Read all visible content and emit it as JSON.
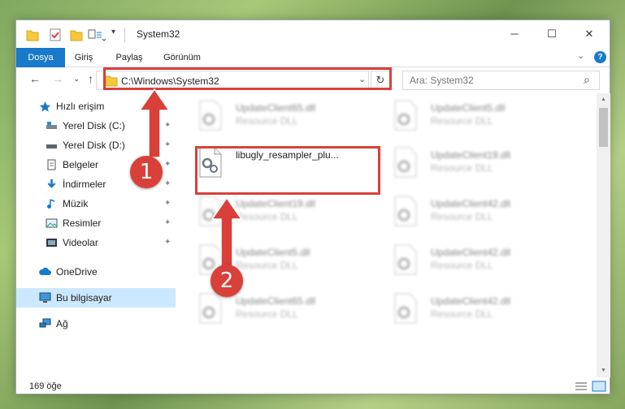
{
  "window": {
    "title": "System32",
    "controls": {
      "minimize": "─",
      "maximize": "☐",
      "close": "✕"
    }
  },
  "ribbon": {
    "tabs": [
      {
        "label": "Dosya",
        "active": true
      },
      {
        "label": "Giriş",
        "active": false
      },
      {
        "label": "Paylaş",
        "active": false
      },
      {
        "label": "Görünüm",
        "active": false
      }
    ],
    "expand_glyph": "⌄",
    "help": "?"
  },
  "nav": {
    "back": "←",
    "forward": "→",
    "recent": "⌄",
    "up": "↑",
    "address": "C:\\Windows\\System32",
    "address_dropdown": "⌄",
    "refresh": "↻",
    "search_placeholder": "Ara: System32",
    "search_glyph": "⌕"
  },
  "sidebar": {
    "items": [
      {
        "label": "Hızlı erişim",
        "icon": "star-icon",
        "pinned": false
      },
      {
        "label": "Yerel Disk (C:)",
        "icon": "drive-icon",
        "pinned": true
      },
      {
        "label": "Yerel Disk (D:)",
        "icon": "drive-icon",
        "pinned": true
      },
      {
        "label": "Belgeler",
        "icon": "documents-icon",
        "pinned": true
      },
      {
        "label": "İndirmeler",
        "icon": "downloads-icon",
        "pinned": true
      },
      {
        "label": "Müzik",
        "icon": "music-icon",
        "pinned": true
      },
      {
        "label": "Resimler",
        "icon": "pictures-icon",
        "pinned": true
      },
      {
        "label": "Videolar",
        "icon": "videos-icon",
        "pinned": true
      },
      {
        "label": "OneDrive",
        "icon": "cloud-icon",
        "pinned": false
      },
      {
        "label": "Bu bilgisayar",
        "icon": "computer-icon",
        "pinned": false,
        "selected": true
      },
      {
        "label": "Ağ",
        "icon": "network-icon",
        "pinned": false
      }
    ],
    "pin_glyph": "📌"
  },
  "files": [
    {
      "name": "UpdateClient65.dll",
      "type": "Resource DLL",
      "highlight": false
    },
    {
      "name": "UpdateClient5.dll",
      "type": "Resource DLL",
      "highlight": false
    },
    {
      "name": "libugly_resampler_plu...",
      "type": "",
      "highlight": true
    },
    {
      "name": "UpdateClient19.dll",
      "type": "Resource DLL",
      "highlight": false
    },
    {
      "name": "UpdateClient19.dll",
      "type": "Resource DLL",
      "highlight": false
    },
    {
      "name": "UpdateClient42.dll",
      "type": "Resource DLL",
      "highlight": false
    },
    {
      "name": "UpdateClient5.dll",
      "type": "Resource DLL",
      "highlight": false
    },
    {
      "name": "UpdateClient42.dll",
      "type": "Resource DLL",
      "highlight": false
    },
    {
      "name": "UpdateClient65.dll",
      "type": "Resource DLL",
      "highlight": false
    },
    {
      "name": "UpdateClient42.dll",
      "type": "Resource DLL",
      "highlight": false
    }
  ],
  "status": {
    "count": "169 öğe"
  },
  "annotations": {
    "step1": "1",
    "step2": "2",
    "color": "#d9403a"
  }
}
